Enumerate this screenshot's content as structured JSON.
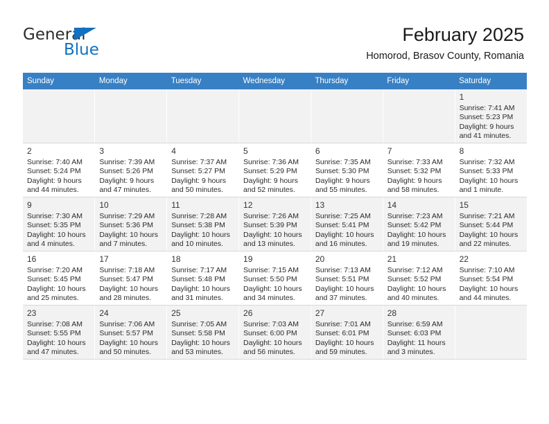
{
  "brand": {
    "name_top": "General",
    "name_bottom": "Blue",
    "icon": "triangle-logo-icon",
    "color": "#1271c0"
  },
  "header": {
    "month_title": "February 2025",
    "location": "Homorod, Brasov County, Romania"
  },
  "calendar": {
    "header_bg": "#3880c4",
    "columns": [
      "Sunday",
      "Monday",
      "Tuesday",
      "Wednesday",
      "Thursday",
      "Friday",
      "Saturday"
    ],
    "weeks": [
      [
        {
          "day": "",
          "lines": []
        },
        {
          "day": "",
          "lines": []
        },
        {
          "day": "",
          "lines": []
        },
        {
          "day": "",
          "lines": []
        },
        {
          "day": "",
          "lines": []
        },
        {
          "day": "",
          "lines": []
        },
        {
          "day": "1",
          "lines": [
            "Sunrise: 7:41 AM",
            "Sunset: 5:23 PM",
            "Daylight: 9 hours",
            "and 41 minutes."
          ]
        }
      ],
      [
        {
          "day": "2",
          "lines": [
            "Sunrise: 7:40 AM",
            "Sunset: 5:24 PM",
            "Daylight: 9 hours",
            "and 44 minutes."
          ]
        },
        {
          "day": "3",
          "lines": [
            "Sunrise: 7:39 AM",
            "Sunset: 5:26 PM",
            "Daylight: 9 hours",
            "and 47 minutes."
          ]
        },
        {
          "day": "4",
          "lines": [
            "Sunrise: 7:37 AM",
            "Sunset: 5:27 PM",
            "Daylight: 9 hours",
            "and 50 minutes."
          ]
        },
        {
          "day": "5",
          "lines": [
            "Sunrise: 7:36 AM",
            "Sunset: 5:29 PM",
            "Daylight: 9 hours",
            "and 52 minutes."
          ]
        },
        {
          "day": "6",
          "lines": [
            "Sunrise: 7:35 AM",
            "Sunset: 5:30 PM",
            "Daylight: 9 hours",
            "and 55 minutes."
          ]
        },
        {
          "day": "7",
          "lines": [
            "Sunrise: 7:33 AM",
            "Sunset: 5:32 PM",
            "Daylight: 9 hours",
            "and 58 minutes."
          ]
        },
        {
          "day": "8",
          "lines": [
            "Sunrise: 7:32 AM",
            "Sunset: 5:33 PM",
            "Daylight: 10 hours",
            "and 1 minute."
          ]
        }
      ],
      [
        {
          "day": "9",
          "lines": [
            "Sunrise: 7:30 AM",
            "Sunset: 5:35 PM",
            "Daylight: 10 hours",
            "and 4 minutes."
          ]
        },
        {
          "day": "10",
          "lines": [
            "Sunrise: 7:29 AM",
            "Sunset: 5:36 PM",
            "Daylight: 10 hours",
            "and 7 minutes."
          ]
        },
        {
          "day": "11",
          "lines": [
            "Sunrise: 7:28 AM",
            "Sunset: 5:38 PM",
            "Daylight: 10 hours",
            "and 10 minutes."
          ]
        },
        {
          "day": "12",
          "lines": [
            "Sunrise: 7:26 AM",
            "Sunset: 5:39 PM",
            "Daylight: 10 hours",
            "and 13 minutes."
          ]
        },
        {
          "day": "13",
          "lines": [
            "Sunrise: 7:25 AM",
            "Sunset: 5:41 PM",
            "Daylight: 10 hours",
            "and 16 minutes."
          ]
        },
        {
          "day": "14",
          "lines": [
            "Sunrise: 7:23 AM",
            "Sunset: 5:42 PM",
            "Daylight: 10 hours",
            "and 19 minutes."
          ]
        },
        {
          "day": "15",
          "lines": [
            "Sunrise: 7:21 AM",
            "Sunset: 5:44 PM",
            "Daylight: 10 hours",
            "and 22 minutes."
          ]
        }
      ],
      [
        {
          "day": "16",
          "lines": [
            "Sunrise: 7:20 AM",
            "Sunset: 5:45 PM",
            "Daylight: 10 hours",
            "and 25 minutes."
          ]
        },
        {
          "day": "17",
          "lines": [
            "Sunrise: 7:18 AM",
            "Sunset: 5:47 PM",
            "Daylight: 10 hours",
            "and 28 minutes."
          ]
        },
        {
          "day": "18",
          "lines": [
            "Sunrise: 7:17 AM",
            "Sunset: 5:48 PM",
            "Daylight: 10 hours",
            "and 31 minutes."
          ]
        },
        {
          "day": "19",
          "lines": [
            "Sunrise: 7:15 AM",
            "Sunset: 5:50 PM",
            "Daylight: 10 hours",
            "and 34 minutes."
          ]
        },
        {
          "day": "20",
          "lines": [
            "Sunrise: 7:13 AM",
            "Sunset: 5:51 PM",
            "Daylight: 10 hours",
            "and 37 minutes."
          ]
        },
        {
          "day": "21",
          "lines": [
            "Sunrise: 7:12 AM",
            "Sunset: 5:52 PM",
            "Daylight: 10 hours",
            "and 40 minutes."
          ]
        },
        {
          "day": "22",
          "lines": [
            "Sunrise: 7:10 AM",
            "Sunset: 5:54 PM",
            "Daylight: 10 hours",
            "and 44 minutes."
          ]
        }
      ],
      [
        {
          "day": "23",
          "lines": [
            "Sunrise: 7:08 AM",
            "Sunset: 5:55 PM",
            "Daylight: 10 hours",
            "and 47 minutes."
          ]
        },
        {
          "day": "24",
          "lines": [
            "Sunrise: 7:06 AM",
            "Sunset: 5:57 PM",
            "Daylight: 10 hours",
            "and 50 minutes."
          ]
        },
        {
          "day": "25",
          "lines": [
            "Sunrise: 7:05 AM",
            "Sunset: 5:58 PM",
            "Daylight: 10 hours",
            "and 53 minutes."
          ]
        },
        {
          "day": "26",
          "lines": [
            "Sunrise: 7:03 AM",
            "Sunset: 6:00 PM",
            "Daylight: 10 hours",
            "and 56 minutes."
          ]
        },
        {
          "day": "27",
          "lines": [
            "Sunrise: 7:01 AM",
            "Sunset: 6:01 PM",
            "Daylight: 10 hours",
            "and 59 minutes."
          ]
        },
        {
          "day": "28",
          "lines": [
            "Sunrise: 6:59 AM",
            "Sunset: 6:03 PM",
            "Daylight: 11 hours",
            "and 3 minutes."
          ]
        },
        {
          "day": "",
          "lines": []
        }
      ]
    ]
  }
}
